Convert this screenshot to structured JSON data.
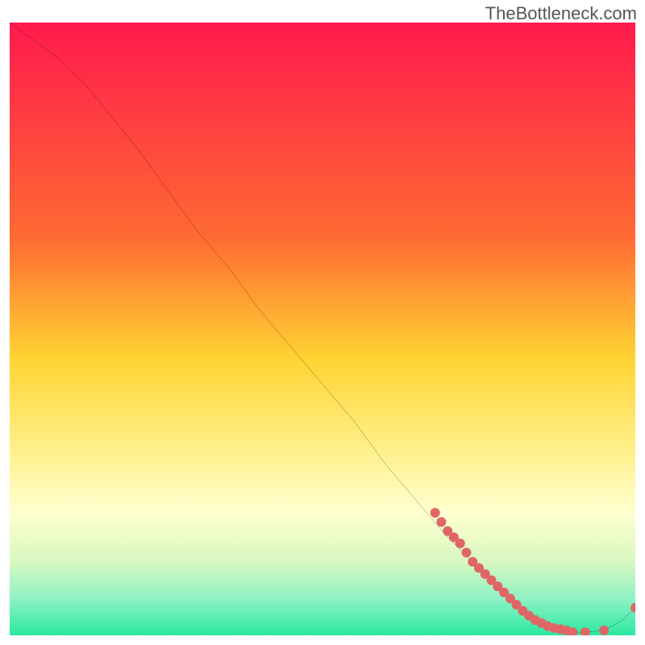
{
  "watermark": "TheBottleneck.com",
  "chart_data": {
    "type": "line",
    "title": "",
    "xlabel": "",
    "ylabel": "",
    "xlim": [
      0,
      100
    ],
    "ylim": [
      0,
      100
    ],
    "grid": false,
    "gradient": {
      "colors": [
        "#ff1a4d",
        "#ff6a33",
        "#ffd433",
        "#fff08c",
        "#ffffd0",
        "#d8f7c0",
        "#8ef2c4",
        "#2be8a1"
      ],
      "positions": [
        0,
        0.35,
        0.55,
        0.7,
        0.8,
        0.88,
        0.94,
        1.0
      ]
    },
    "curve": {
      "x": [
        0,
        4,
        8,
        12,
        16,
        20,
        25,
        30,
        35,
        40,
        45,
        50,
        55,
        60,
        65,
        70,
        74,
        78,
        80,
        82,
        84,
        86,
        88,
        90,
        92,
        95,
        98,
        100
      ],
      "y": [
        100,
        97,
        94,
        90,
        85,
        80,
        73,
        66,
        60,
        53,
        47,
        41,
        35,
        28,
        22,
        16,
        12,
        8,
        6,
        4,
        3,
        2,
        1,
        0.5,
        0.5,
        0.8,
        2.5,
        4.5
      ]
    },
    "markers": {
      "color": "#e06666",
      "radius": 6,
      "x": [
        68,
        69,
        70,
        71,
        72,
        73,
        74,
        75,
        76,
        77,
        78,
        79,
        80,
        81,
        82,
        83,
        84,
        85,
        86,
        87,
        88,
        89,
        90,
        92,
        95,
        100
      ],
      "y": [
        20,
        18.5,
        17,
        16,
        15,
        13.5,
        12,
        11,
        10,
        9,
        8,
        7,
        6,
        5,
        4,
        3.2,
        2.5,
        2,
        1.5,
        1.2,
        1.0,
        0.8,
        0.5,
        0.5,
        0.8,
        4.5
      ]
    }
  }
}
